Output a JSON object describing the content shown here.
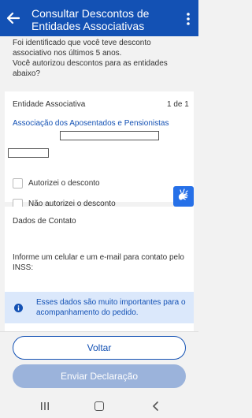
{
  "header": {
    "title": "Consultar Descontos de Entidades Associativas",
    "back_icon": "arrow-left-icon",
    "menu_icon": "more-vertical-icon"
  },
  "intro": {
    "line1": "Foi identificado que você teve desconto associativo nos últimos 5 anos.",
    "line2": "Você autorizou descontos para as entidades abaixo?"
  },
  "entity_card": {
    "title": "Entidade Associativa",
    "count": "1 de 1",
    "entity_name": "Associação dos Aposentados e Pensionistas",
    "options": [
      {
        "label": "Autorizei o desconto",
        "checked": false
      },
      {
        "label": "Não autorizei o desconto",
        "checked": false
      }
    ]
  },
  "accessibility_icon": "hand-sign-language-icon",
  "contact_card": {
    "title": "Dados de Contato",
    "description": "Informe um celular e um e-mail para contato pelo INSS:",
    "info": "Esses dados são muito importantes para o acompanhamento do pedido."
  },
  "actions": {
    "back_label": "Voltar",
    "submit_label": "Enviar Declaração"
  },
  "colors": {
    "primary": "#1351b4",
    "disabled": "#9bb3db",
    "info_bg": "#dbe8fb",
    "accessibility": "#2670e8"
  }
}
